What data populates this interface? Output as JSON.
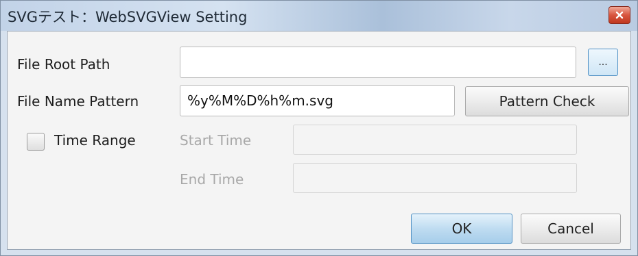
{
  "window": {
    "title": "SVGテスト：WebSVGView Setting",
    "close_icon": "close-icon"
  },
  "form": {
    "root_path": {
      "label": "File Root Path",
      "value": "",
      "browse_label": "..."
    },
    "name_pattern": {
      "label": "File Name Pattern",
      "value": "%y%M%D%h%m.svg",
      "check_label": "Pattern Check"
    },
    "time_range": {
      "label": "Time Range",
      "checked": false,
      "start_label": "Start Time",
      "start_value": "",
      "end_label": "End Time",
      "end_value": ""
    }
  },
  "actions": {
    "ok_label": "OK",
    "cancel_label": "Cancel"
  },
  "colors": {
    "close_button": "#d8553f",
    "primary_button": "#a6cdea"
  }
}
